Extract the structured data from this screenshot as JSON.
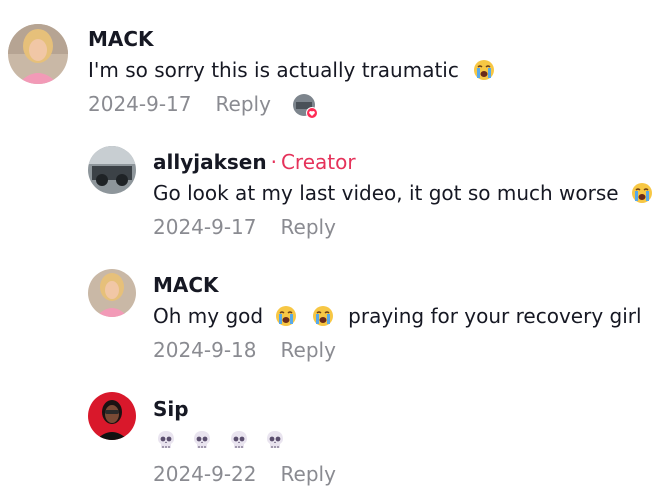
{
  "comments": [
    {
      "user": "MACK",
      "text": "I'm so sorry this is actually traumatic",
      "emoji": [
        "loudly-crying-face-emoji"
      ],
      "date": "2024-9-17",
      "reply": "Reply",
      "avatar": "blonde-woman-pink-top"
    },
    {
      "user": "allyjaksen",
      "badge_sep": "·",
      "badge": "Creator",
      "text": "Go look at my last video, it got so much worse",
      "emoji": [
        "loudly-crying-face-emoji"
      ],
      "date": "2024-9-17",
      "reply": "Reply",
      "avatar": "motorcycles-photo"
    },
    {
      "user": "MACK",
      "text_before": "Oh my god",
      "text_after": "praying for your recovery girl",
      "emoji": [
        "loudly-crying-face-emoji",
        "loudly-crying-face-emoji"
      ],
      "date": "2024-9-18",
      "reply": "Reply",
      "avatar": "blonde-woman-pink-top"
    },
    {
      "user": "Sip",
      "text": "",
      "emoji": [
        "skull-emoji",
        "skull-emoji",
        "skull-emoji",
        "skull-emoji"
      ],
      "date": "2024-9-22",
      "reply": "Reply",
      "avatar": "person-red-background"
    }
  ],
  "colors": {
    "creator": "#e5325a",
    "meta": "#8a8b91",
    "text": "#161823"
  }
}
